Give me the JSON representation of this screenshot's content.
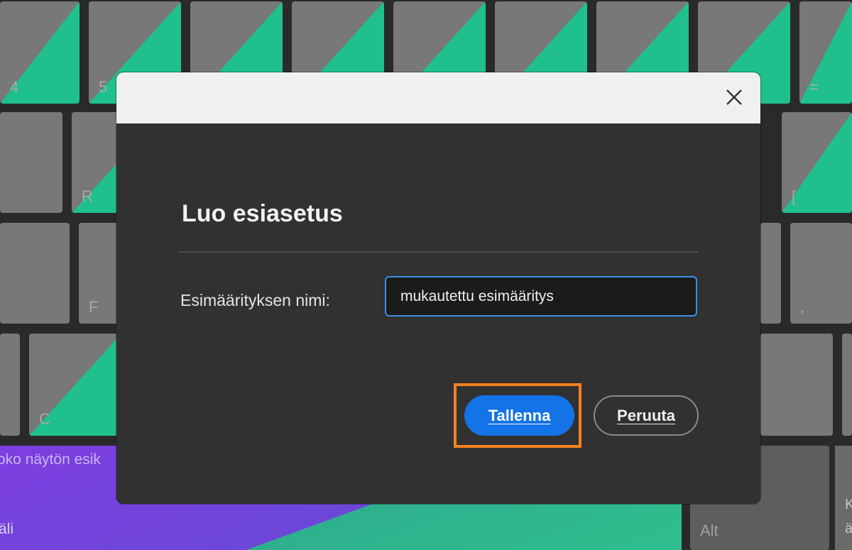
{
  "dialog": {
    "title": "Luo esiasetus",
    "close_icon": "close-icon",
    "field_label": "Esimäärityksen nimi:",
    "name_value": "mukautettu esimääritys",
    "save_label": "Tallenna",
    "cancel_label": "Peruuta"
  },
  "background": {
    "keys": {
      "k4": "4",
      "k5": "5",
      "kEquals": "=",
      "kR": "R",
      "kBracket": "[",
      "kF": "F",
      "kComma": ",",
      "kC": "C",
      "alt": "Alt"
    },
    "purple_label_top": "oko näytön esik",
    "purple_label_bottom": "äli",
    "edge_key_top": "K",
    "edge_key_bottom": "ä"
  },
  "colors": {
    "accent": "#1473e6",
    "highlight": "#f5821f",
    "key_green": "#1fbf8e",
    "zone_purple": "#7d3ee0"
  }
}
